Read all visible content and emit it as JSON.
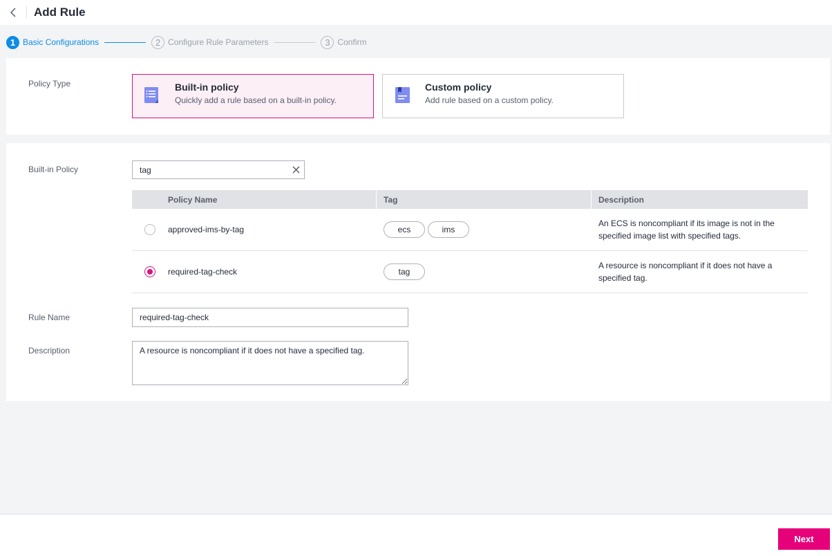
{
  "header": {
    "title": "Add Rule",
    "back_icon": "chevron-left-icon"
  },
  "steps": [
    {
      "num": "1",
      "label": "Basic Configurations",
      "active": true
    },
    {
      "num": "2",
      "label": "Configure Rule Parameters",
      "active": false
    },
    {
      "num": "3",
      "label": "Confirm",
      "active": false
    }
  ],
  "policy_type": {
    "label": "Policy Type",
    "options": [
      {
        "title": "Built-in policy",
        "desc": "Quickly add a rule based on a built-in policy.",
        "selected": true,
        "icon": "list-document-icon"
      },
      {
        "title": "Custom policy",
        "desc": "Add rule based on a custom policy.",
        "selected": false,
        "icon": "bookmark-document-icon"
      }
    ]
  },
  "builtin": {
    "label": "Built-in Policy",
    "search_value": "tag",
    "table": {
      "headers": {
        "name": "Policy Name",
        "tag": "Tag",
        "description": "Description"
      },
      "rows": [
        {
          "name": "approved-ims-by-tag",
          "tags": [
            "ecs",
            "ims"
          ],
          "description": "An ECS is noncompliant if its image is not in the specified image list with specified tags.",
          "selected": false
        },
        {
          "name": "required-tag-check",
          "tags": [
            "tag"
          ],
          "description": "A resource is noncompliant if it does not have a specified tag.",
          "selected": true
        }
      ]
    }
  },
  "rule_name": {
    "label": "Rule Name",
    "value": "required-tag-check"
  },
  "description": {
    "label": "Description",
    "value": "A resource is noncompliant if it does not have a specified tag."
  },
  "footer": {
    "next_label": "Next"
  },
  "colors": {
    "accent": "#e6007a",
    "step_active": "#0c8de6",
    "selected_border": "#d9137f"
  }
}
